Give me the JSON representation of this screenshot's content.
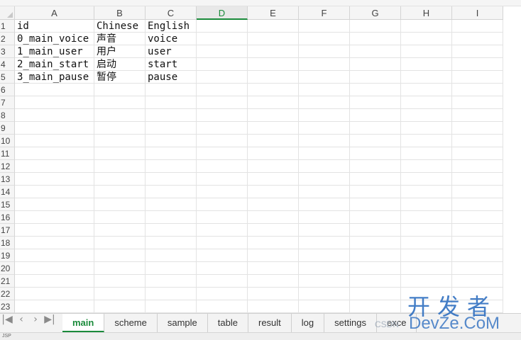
{
  "columns": [
    "A",
    "B",
    "C",
    "D",
    "E",
    "F",
    "G",
    "H",
    "I"
  ],
  "active_column": "D",
  "rows": [
    "1",
    "2",
    "3",
    "4",
    "5",
    "6",
    "7",
    "8",
    "9",
    "10",
    "11",
    "12",
    "13",
    "14",
    "15",
    "16",
    "17",
    "18",
    "19",
    "20",
    "21",
    "22",
    "23"
  ],
  "cells": [
    [
      "id",
      "Chinese",
      "English"
    ],
    [
      "0_main_voice",
      "声音",
      "voice"
    ],
    [
      "1_main_user",
      "用户",
      "user"
    ],
    [
      "2_main_start",
      "启动",
      "start"
    ],
    [
      "3_main_pause",
      "暂停",
      "pause"
    ]
  ],
  "nav": {
    "first": "|◀",
    "prev": "‹",
    "next": "›",
    "last": "▶|"
  },
  "sheet_tabs": [
    "main",
    "scheme",
    "sample",
    "table",
    "result",
    "log",
    "settings",
    "exce"
  ],
  "active_tab": "main",
  "status": {
    "text": "JSP"
  },
  "watermark": {
    "chinese": "开发者",
    "english": "DevZe.CoM",
    "csdn": "CSDN"
  },
  "colors": {
    "accent": "#1a8a3a",
    "watermark": "#2f6fc0"
  }
}
